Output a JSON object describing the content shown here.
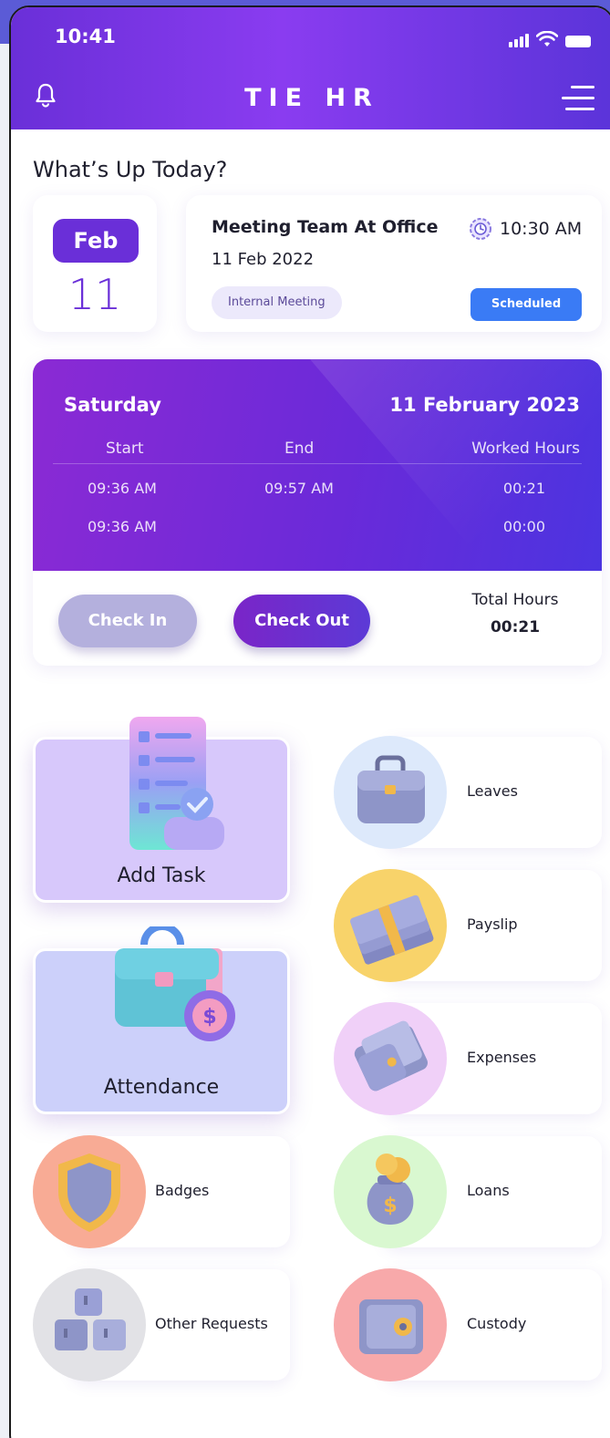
{
  "status_bar": {
    "time": "10:41"
  },
  "header": {
    "title": "TIE HR"
  },
  "section": {
    "title": "What’s Up Today?"
  },
  "date_card": {
    "month": "Feb",
    "day": "11"
  },
  "meeting": {
    "title": "Meeting Team At Office",
    "time": "10:30 AM",
    "date": "11 Feb 2022",
    "tag": "Internal Meeting",
    "status": "Scheduled"
  },
  "attendance": {
    "weekday": "Saturday",
    "date": "11 February 2023",
    "columns": [
      "Start",
      "End",
      "Worked Hours"
    ],
    "rows": [
      {
        "start": "09:36 AM",
        "end": "09:57 AM",
        "worked": "00:21"
      },
      {
        "start": "09:36 AM",
        "end": "",
        "worked": "00:00"
      }
    ],
    "check_in_label": "Check In",
    "check_out_label": "Check Out",
    "total_label": "Total Hours",
    "total_value": "00:21"
  },
  "tiles": {
    "add_task": "Add Task",
    "attendance": "Attendance",
    "leaves": "Leaves",
    "payslip": "Payslip",
    "expenses": "Expenses",
    "loans": "Loans",
    "badges": "Badges",
    "other_requests": "Other Requests",
    "custody": "Custody"
  },
  "colors": {
    "brand": "#6a2fd8",
    "scheduled": "#3a7bf5",
    "leaves_circle": "#dde9fb",
    "payslip_circle": "#f8d36a",
    "expenses_circle": "#f0d0f8",
    "loans_circle": "#d9f8d0",
    "badges_circle": "#f8ab95",
    "other_circle": "#e2e2e6",
    "custody_circle": "#f8a9aa"
  }
}
